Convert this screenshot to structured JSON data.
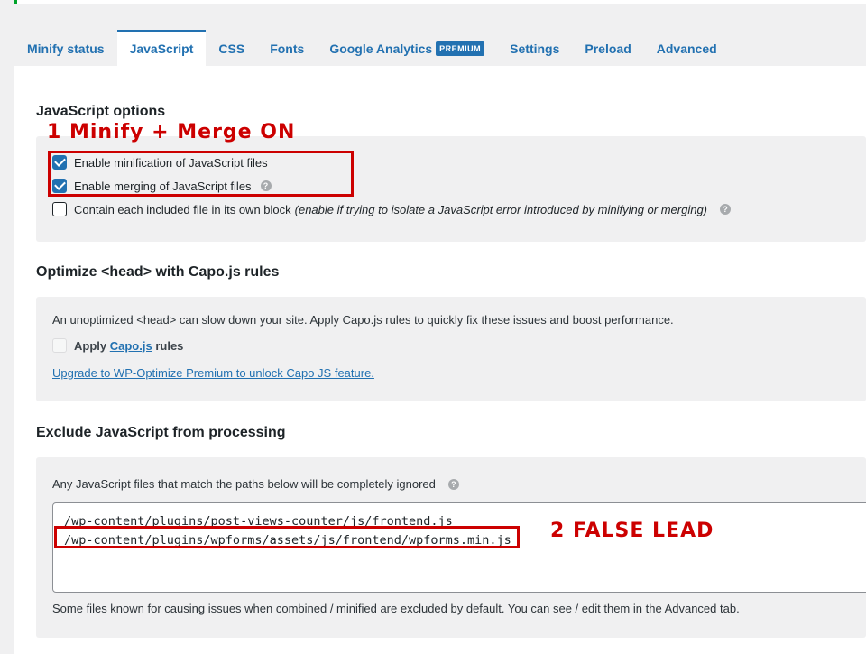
{
  "tabs": [
    {
      "label": "Minify status"
    },
    {
      "label": "JavaScript"
    },
    {
      "label": "CSS"
    },
    {
      "label": "Fonts"
    },
    {
      "label": "Google Analytics",
      "badge": "PREMIUM"
    },
    {
      "label": "Settings"
    },
    {
      "label": "Preload"
    },
    {
      "label": "Advanced"
    }
  ],
  "active_tab": "JavaScript",
  "js_options": {
    "title": "JavaScript options",
    "minify_label": "Enable minification of JavaScript files",
    "merge_label": "Enable merging of JavaScript files",
    "contain_label": "Contain each included file in its own block",
    "contain_hint": "(enable if trying to isolate a JavaScript error introduced by minifying or merging)"
  },
  "capo": {
    "title": "Optimize <head> with Capo.js rules",
    "description": "An unoptimized <head> can slow down your site. Apply Capo.js rules to quickly fix these issues and boost performance.",
    "apply_prefix": "Apply",
    "apply_link": "Capo.js",
    "apply_suffix": "rules",
    "upgrade_link": "Upgrade to WP-Optimize Premium to unlock Capo JS feature."
  },
  "exclude": {
    "title": "Exclude JavaScript from processing",
    "description": "Any JavaScript files that match the paths below will be completely ignored",
    "paths": [
      "/wp-content/plugins/post-views-counter/js/frontend.js",
      "/wp-content/plugins/wpforms/assets/js/frontend/wpforms.min.js"
    ],
    "footer": "Some files known for causing issues when combined / minified are excluded by default. You can see / edit them in the Advanced tab."
  },
  "annotations": {
    "one": "1  Minify + Merge ON",
    "two": "2  FALSE LEAD",
    "color": "#cc0000"
  },
  "colors": {
    "accent": "#2271b1",
    "background": "#f0f0f1"
  }
}
